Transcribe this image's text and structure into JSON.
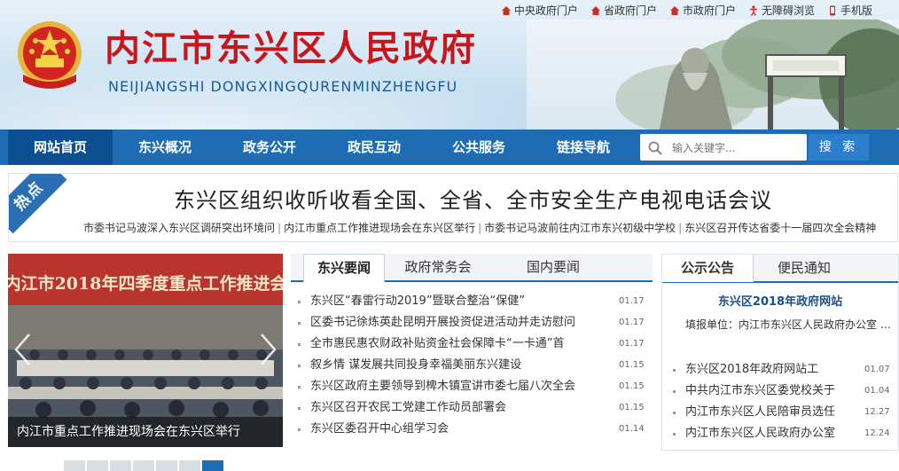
{
  "header": {
    "title": "内江市东兴区人民政府",
    "pinyin": "NEIJIANGSHI  DONGXINGQURENMINZHENGFU",
    "top_links": [
      "中央政府门户",
      "省政府门户",
      "市政府门户",
      "无障碍浏览",
      "手机版"
    ]
  },
  "nav": {
    "items": [
      "网站首页",
      "东兴概况",
      "政务公开",
      "政民互动",
      "公共服务",
      "链接导航"
    ],
    "active": "网站首页",
    "search_placeholder": "输入关键字...",
    "search_button": "搜 索"
  },
  "hot": {
    "tag": "热点",
    "headline": "东兴区组织收听收看全国、全省、全市安全生产电视电话会议",
    "sub_links": [
      "市委书记马波深入东兴区调研突出环境问",
      "内江市重点工作推进现场会在东兴区举行",
      "市委书记马波前往内江市东兴初级中学校",
      "东兴区召开传达省委十一届四次全会精神"
    ]
  },
  "slideshow": {
    "banner_text": "内江市2018年四季度重点工作推进会",
    "caption": "内江市重点工作推进现场会在东兴区举行",
    "dot_count": 7,
    "active_dot": 7
  },
  "news": {
    "tabs": [
      "东兴要闻",
      "政府常务会",
      "国内要闻"
    ],
    "active_tab": "东兴要闻",
    "items": [
      {
        "title": "东兴区“春雷行动2019”暨联合整治“保健”",
        "date": "01.17"
      },
      {
        "title": "区委书记徐炼英赴昆明开展投资促进活动并走访慰问",
        "date": "01.17"
      },
      {
        "title": "全市惠民惠农财政补贴资金社会保障卡“一卡通”首",
        "date": "01.17"
      },
      {
        "title": "叙乡情 谋发展共同投身幸福美丽东兴建设",
        "date": "01.15"
      },
      {
        "title": "东兴区政府主要领导到椑木镇宣讲市委七届八次全会",
        "date": "01.15"
      },
      {
        "title": "东兴区召开农民工党建工作动员部署会",
        "date": "01.15"
      },
      {
        "title": "东兴区委召开中心组学习会",
        "date": "01.14"
      }
    ]
  },
  "notices": {
    "tabs": [
      "公示公告",
      "便民通知"
    ],
    "active_tab": "公示公告",
    "featured_title": "东兴区2018年政府网站",
    "featured_desc": "填报单位：内江市东兴区人民政府办公室 …",
    "items": [
      {
        "title": "东兴区2018年政府网站工",
        "date": "01.07"
      },
      {
        "title": "中共内江市东兴区委党校关于",
        "date": "01.04"
      },
      {
        "title": "内江市东兴区人民陪审员选任",
        "date": "12.27"
      },
      {
        "title": "内江市东兴区人民政府办公室",
        "date": "12.24"
      }
    ]
  },
  "colors": {
    "nav_blue": "#1e6cb3",
    "nav_active": "#0d4f93",
    "title_red": "#c8161d"
  }
}
